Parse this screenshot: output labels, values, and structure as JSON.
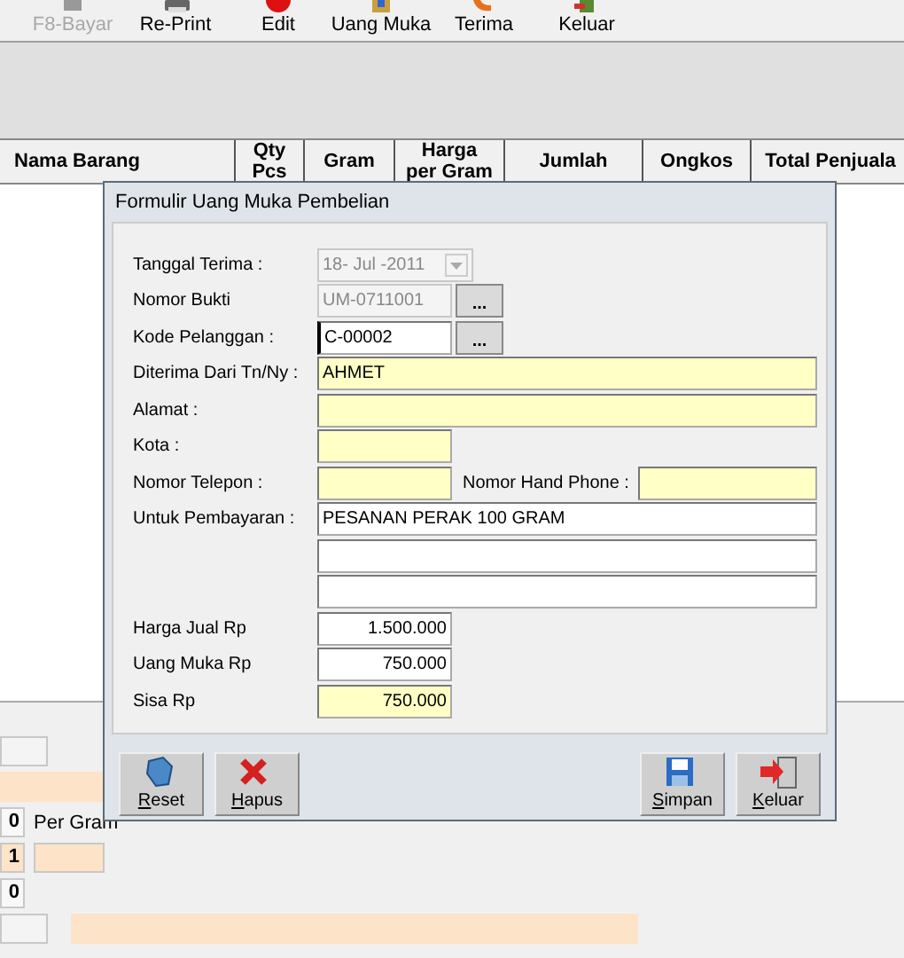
{
  "toolbar": [
    {
      "label": "F8-Bayar",
      "disabled": true,
      "kind": "pay"
    },
    {
      "label": "Re-Print",
      "disabled": false,
      "kind": "print"
    },
    {
      "label": "Edit",
      "disabled": false,
      "kind": "edit"
    },
    {
      "label": "Uang Muka",
      "disabled": false,
      "kind": "advance"
    },
    {
      "label": "Terima",
      "disabled": false,
      "kind": "receive"
    },
    {
      "label": "Keluar",
      "disabled": false,
      "kind": "exit"
    }
  ],
  "table": {
    "columns": [
      {
        "lines": [
          "Nama Barang"
        ]
      },
      {
        "lines": [
          "Qty",
          "Pcs"
        ]
      },
      {
        "lines": [
          "Gram"
        ]
      },
      {
        "lines": [
          "Harga",
          "per  Gram"
        ]
      },
      {
        "lines": [
          "Jumlah"
        ]
      },
      {
        "lines": [
          "Ongkos"
        ]
      },
      {
        "lines": [
          "Total Penjuala"
        ]
      }
    ]
  },
  "bottom_panel": {
    "rows": [
      [
        {
          "kind": "plain"
        }
      ],
      [
        {
          "kind": "tinted",
          "wide": false
        }
      ],
      [
        {
          "kind": "number",
          "value": "0"
        },
        {
          "kind": "label",
          "text": "Per Gram"
        }
      ],
      [
        {
          "kind": "number",
          "value": "1",
          "tinted": true
        },
        {
          "kind": "tinted",
          "wide": false
        }
      ],
      [
        {
          "kind": "number",
          "value": "0"
        }
      ],
      [
        {
          "kind": "plain"
        },
        {
          "kind": "tinted",
          "wide": true
        }
      ]
    ]
  },
  "dialog": {
    "title": "Formulir Uang Muka Pembelian",
    "rows": [
      {
        "label": "Tanggal Terima :",
        "kind": "combo",
        "value": "18-  Jul  -2011",
        "disabled": true
      },
      {
        "label": "Nomor Bukti",
        "kind": "lookup",
        "value": "UM-0711001",
        "disabled": true,
        "button": "..."
      },
      {
        "label": "Kode Pelanggan  :",
        "kind": "lookup",
        "value": "C-00002",
        "disabled": false,
        "focused": true,
        "button": "..."
      },
      {
        "label": "Diterima Dari Tn/Ny :",
        "kind": "wide",
        "value": "AHMET",
        "highlighted": true
      },
      {
        "label": "Alamat :",
        "kind": "wide",
        "highlighted": true
      },
      {
        "label": "Kota :",
        "kind": "short",
        "highlighted": true
      },
      {
        "label": "Nomor Telepon :",
        "kind": "pair",
        "highlighted": true,
        "label_2": "Nomor Hand Phone :"
      },
      {
        "label": "Untuk Pembayaran :",
        "kind": "wide",
        "value": "PESANAN PERAK 100 GRAM",
        "highlighted": false
      },
      {
        "kind": "wide",
        "highlighted": false
      },
      {
        "kind": "wide",
        "highlighted": false
      },
      {
        "label": "Harga Jual Rp",
        "kind": "amount",
        "value": "1.500.000",
        "highlighted": false
      },
      {
        "label": "Uang Muka Rp",
        "kind": "amount",
        "value": "750.000",
        "highlighted": false
      },
      {
        "label": "Sisa Rp",
        "kind": "amount",
        "value": "750.000",
        "highlighted": true
      }
    ],
    "buttons_left": [
      {
        "label": "Reset",
        "kind": "reset"
      },
      {
        "label": "Hapus",
        "kind": "delete"
      }
    ],
    "buttons_right": [
      {
        "label": "Simpan",
        "kind": "save"
      },
      {
        "label": "Keluar",
        "kind": "exit"
      }
    ]
  }
}
